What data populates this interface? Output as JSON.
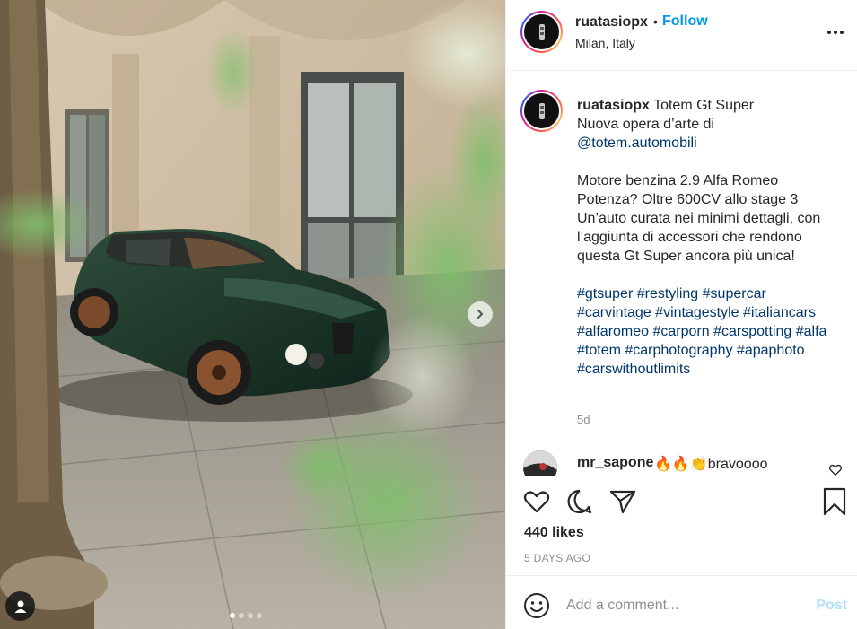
{
  "post": {
    "username": "ruatasiopx",
    "separator": "•",
    "follow_label": "Follow",
    "location": "Milan, Italy"
  },
  "caption": {
    "username": "ruatasiopx",
    "title": "Totem Gt Super",
    "line2": "Nuova opera d’arte di",
    "mention": "@totem.automobili",
    "body": "Motore benzina 2.9 Alfa Romeo Potenza? Oltre 600CV allo stage 3 Un’auto curata nei minimi dettagli, con l’aggiunta di accessori che rendono questa Gt Super ancora più unica!",
    "hashtags": [
      "#gtsuper",
      "#restyling",
      "#supercar",
      "#carvintage",
      "#vintagestyle",
      "#italiancars",
      "#alfaromeo",
      "#carporn",
      "#carspotting",
      "#alfa",
      "#totem",
      "#carphotography",
      "#apaphoto",
      "#carswithoutlimits"
    ],
    "time_ago": "5d"
  },
  "comment": {
    "username": "mr_sapone",
    "text": "🔥🔥👏bravoooo"
  },
  "stats": {
    "likes": "440 likes",
    "date": "5 DAYS AGO"
  },
  "composer": {
    "placeholder": "Add a comment...",
    "post_label": "Post"
  },
  "carousel": {
    "slides": 4,
    "active": 0
  },
  "colors": {
    "accent": "#0095f6",
    "link": "#00376b",
    "post_disabled": "#b2dffc",
    "car_green": "#1f3a2c"
  },
  "icons": [
    "heart-icon",
    "comment-icon",
    "share-icon",
    "bookmark-icon",
    "emoji-icon",
    "more-icon",
    "chevron-right-icon",
    "user-tag-icon"
  ]
}
